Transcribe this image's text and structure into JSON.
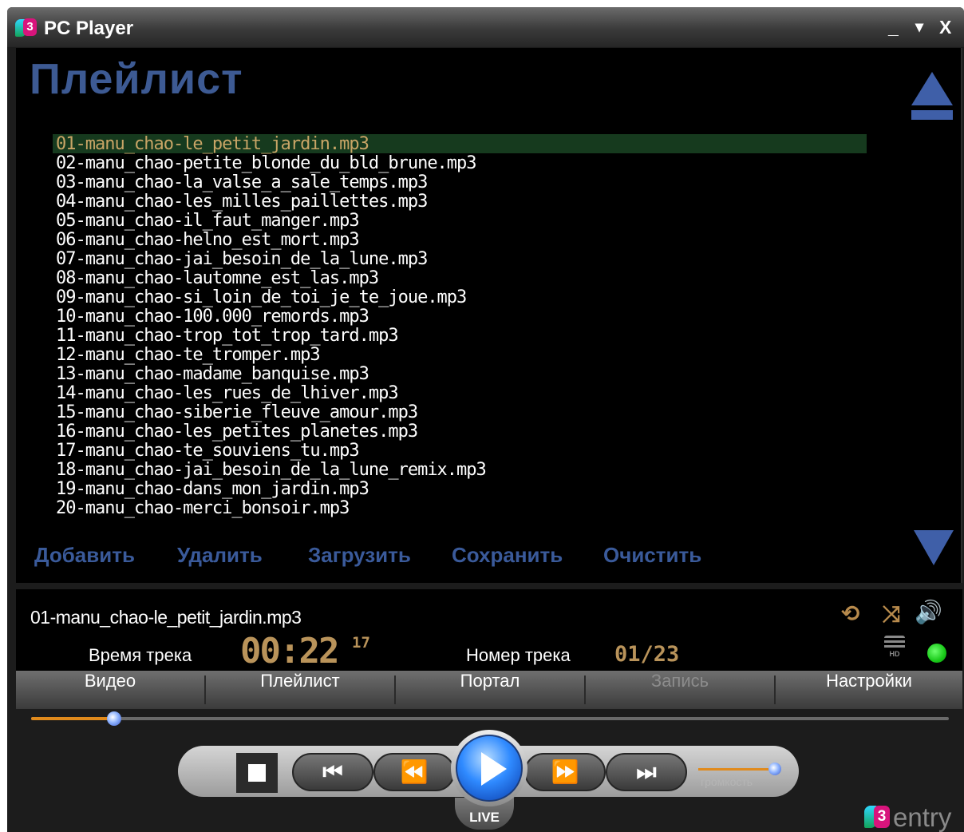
{
  "window": {
    "title": "PC Player",
    "logo_text": "3",
    "controls": {
      "minimize": "_",
      "menu": "▾",
      "close": "X"
    }
  },
  "playlist": {
    "heading": "Плейлист",
    "tracks": [
      "01-manu_chao-le_petit_jardin.mp3",
      "02-manu_chao-petite_blonde_du_bld_brune.mp3",
      "03-manu_chao-la_valse_a_sale_temps.mp3",
      "04-manu_chao-les_milles_paillettes.mp3",
      "05-manu_chao-il_faut_manger.mp3",
      "06-manu_chao-helno_est_mort.mp3",
      "07-manu_chao-jai_besoin_de_la_lune.mp3",
      "08-manu_chao-lautomne_est_las.mp3",
      "09-manu_chao-si_loin_de_toi_je_te_joue.mp3",
      "10-manu_chao-100.000_remords.mp3",
      "11-manu_chao-trop_tot_trop_tard.mp3",
      "12-manu_chao-te_tromper.mp3",
      "13-manu_chao-madame_banquise.mp3",
      "14-manu_chao-les_rues_de_lhiver.mp3",
      "15-manu_chao-siberie_fleuve_amour.mp3",
      "16-manu_chao-les_petites_planetes.mp3",
      "17-manu_chao-te_souviens_tu.mp3",
      "18-manu_chao-jai_besoin_de_la_lune_remix.mp3",
      "19-manu_chao-dans_mon_jardin.mp3",
      "20-manu_chao-merci_bonsoir.mp3"
    ],
    "selected_index": 0,
    "actions": {
      "add": "Добавить",
      "delete": "Удалить",
      "load": "Загрузить",
      "save": "Сохранить",
      "clear": "Очистить"
    }
  },
  "info": {
    "now_playing": "01-manu_chao-le_petit_jardin.mp3",
    "time_label": "Время трека",
    "time_main": "00:22",
    "time_fraction": "17",
    "track_label": "Номер трека",
    "track_number": "01/23",
    "hd_label": "HD"
  },
  "tabs": [
    "Видео",
    "Плейлист",
    "Портал",
    "Запись",
    "Настройки"
  ],
  "tab_disabled_index": 3,
  "transport": {
    "seek_fraction": 0.09,
    "volume_fraction": 0.95,
    "volume_label": "громкость",
    "live_label": "LIVE"
  },
  "brand": {
    "num": "3",
    "word": "entry"
  },
  "colors": {
    "accent_blue": "#3a5a9a",
    "time_gold": "#b9935a",
    "selected_row": "#163a1e",
    "seek_orange": "#e08a1c"
  }
}
